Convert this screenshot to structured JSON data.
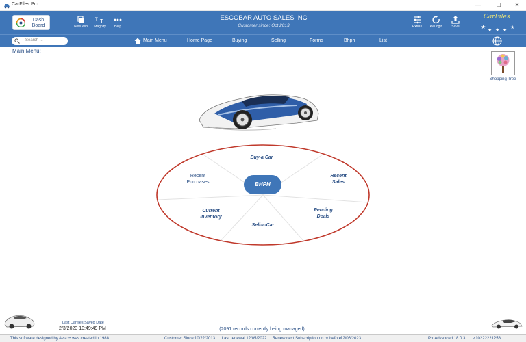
{
  "window": {
    "title": "CarFiles Pro",
    "minimize": "—",
    "maximize": "☐",
    "close": "✕"
  },
  "header": {
    "dash_line1": "Dash",
    "dash_line2": "Board",
    "tools": {
      "new_win": "New Win",
      "magnify": "Magnify",
      "help": "Help",
      "extras": "Extras",
      "relogin": "ReLogin",
      "save": "Save"
    },
    "company": "ESCOBAR AUTO SALES INC",
    "customer_since": "Customer since: Oct 2013",
    "logo_text": "CarFiles"
  },
  "nav": {
    "search_placeholder": "Search ...",
    "items": [
      "Main Menu",
      "Home Page",
      "Buying",
      "Selling",
      "Forms",
      "Bhph",
      "List"
    ]
  },
  "main": {
    "heading": "Main Menu:",
    "shopping_tree": "Shopping Tree",
    "wheel": {
      "center": "BHPH",
      "buy": "Buy-a Car",
      "recent_purchases_1": "Recent",
      "recent_purchases_2": "Purchases",
      "recent_sales_1": "Recent",
      "recent_sales_2": "Sales",
      "current_inventory_1": "Current",
      "current_inventory_2": "Inventory",
      "pending_deals_1": "Pending",
      "pending_deals_2": "Deals",
      "sell": "Sell-a-Car"
    }
  },
  "footer": {
    "saved_label": "Last Carfiles Saved Date",
    "saved_date": "2/3/2023 10:49:49 PM",
    "records": "(2091 records currently being managed)"
  },
  "status": {
    "designed": "This software designed by Avia™ was created in 1988",
    "customer_since": "Customer Since:",
    "customer_since_date": "10/22/2013",
    "renewal": "... Last renewal 12/05/2022 ... Renew next Subscription on or before:",
    "renew_date": "12/06/2023",
    "version": "ProAdvanced 18.0.3",
    "build": "v.10222221258"
  },
  "colors": {
    "accent": "#3f76b8",
    "wheel_border": "#c0392b",
    "text_dark_blue": "#2a4f85"
  }
}
